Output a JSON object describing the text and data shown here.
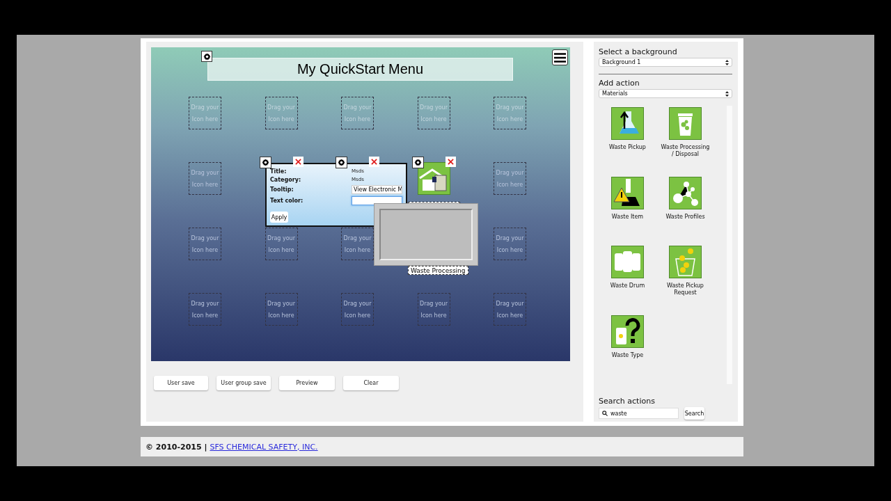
{
  "canvas": {
    "title": "My QuickStart Menu",
    "rows": [
      [
        {
          "kind": "slot",
          "lines": [
            "Drag your",
            "Icon here"
          ]
        },
        {
          "kind": "slot",
          "lines": [
            "Drag your",
            "Icon here"
          ]
        },
        {
          "kind": "slot",
          "lines": [
            "Drag your",
            "Icon here"
          ]
        },
        {
          "kind": "slot",
          "lines": [
            "Drag your",
            "Icon here"
          ]
        },
        {
          "kind": "slot",
          "lines": [
            "Drag your",
            "Icon here"
          ]
        }
      ],
      [
        {
          "kind": "slot",
          "lines": [
            "Drag your",
            "Icon here"
          ]
        },
        {
          "kind": "action"
        },
        {
          "kind": "action"
        },
        {
          "kind": "tile"
        },
        {
          "kind": "slot",
          "lines": [
            "Drag your",
            "Icon here"
          ]
        }
      ],
      [
        {
          "kind": "slot",
          "lines": [
            "Drag your",
            "Icon here"
          ]
        },
        {
          "kind": "slot",
          "lines": [
            "Drag your",
            "Icon here"
          ]
        },
        {
          "kind": "slot",
          "lines": [
            "Drag your",
            "Icon here"
          ]
        },
        {
          "kind": "covered"
        },
        {
          "kind": "slot",
          "lines": [
            "Drag your",
            "Icon here"
          ]
        }
      ],
      [
        {
          "kind": "slot",
          "lines": [
            "Drag your",
            "Icon here"
          ]
        },
        {
          "kind": "slot",
          "lines": [
            "Drag your",
            "Icon here"
          ]
        },
        {
          "kind": "slot",
          "lines": [
            "Drag your",
            "Icon here"
          ]
        },
        {
          "kind": "slot",
          "lines": [
            "Drag your",
            "Icon here"
          ]
        },
        {
          "kind": "slot",
          "lines": [
            "Drag your",
            "Icon here"
          ]
        }
      ]
    ],
    "popup": {
      "fields": [
        {
          "label": "Title:",
          "kind": "text",
          "value": "Msds"
        },
        {
          "label": "Category:",
          "kind": "text",
          "value": "Msds"
        },
        {
          "label": "Tooltip:",
          "kind": "input",
          "value": "View Electronic M",
          "focused": false
        },
        {
          "label": "Text color:",
          "kind": "input",
          "focused": true
        }
      ],
      "button": "Apply"
    },
    "floating_label": "Waste Processing"
  },
  "buttons": [
    "User save",
    "User group save",
    "Preview",
    "Clear"
  ],
  "sidebar": {
    "background_heading": "Select a background",
    "background_value": "Background 1",
    "action_heading": "Add action",
    "action_value": "Materials",
    "actions": [
      {
        "label": "Waste Pickup"
      },
      {
        "label": "Waste Processing / Disposal"
      },
      {
        "label": "Waste Item"
      },
      {
        "label": "Waste Profiles"
      },
      {
        "label": "Waste Drum"
      },
      {
        "label": "Waste Pickup Request"
      },
      {
        "label": "Waste Type"
      }
    ],
    "search_heading": "Search actions",
    "search_value": "waste",
    "search_button": "Search"
  },
  "footer": {
    "copyright": "© 2010-2015 |",
    "link": "SFS CHEMICAL SAFETY, INC."
  }
}
